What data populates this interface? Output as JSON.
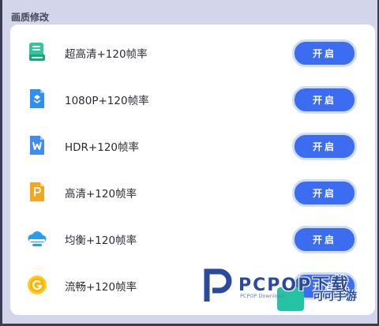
{
  "section": {
    "title": "画质修改"
  },
  "colors": {
    "accent": "#3c6cf0",
    "button_border": "#cddcff",
    "background": "#d3d6ea"
  },
  "rows": [
    {
      "icon": "green-book-icon",
      "label": "超高清+120帧率",
      "button": "开启"
    },
    {
      "icon": "blue-doc-icon",
      "label": "1080P+120帧率",
      "button": "开启"
    },
    {
      "icon": "word-doc-icon",
      "label": "HDR+120帧率",
      "button": "开启"
    },
    {
      "icon": "powerpoint-doc-icon",
      "label": "高清+120帧率",
      "button": "开启"
    },
    {
      "icon": "cloud-icon",
      "label": "均衡+120帧率",
      "button": "开启"
    },
    {
      "icon": "g-circle-icon",
      "label": "流畅+120帧率",
      "button": "开启"
    }
  ],
  "watermark": {
    "brand": "PCPOP下载",
    "sub": "PCPOP Download",
    "tag": "可可手游"
  }
}
